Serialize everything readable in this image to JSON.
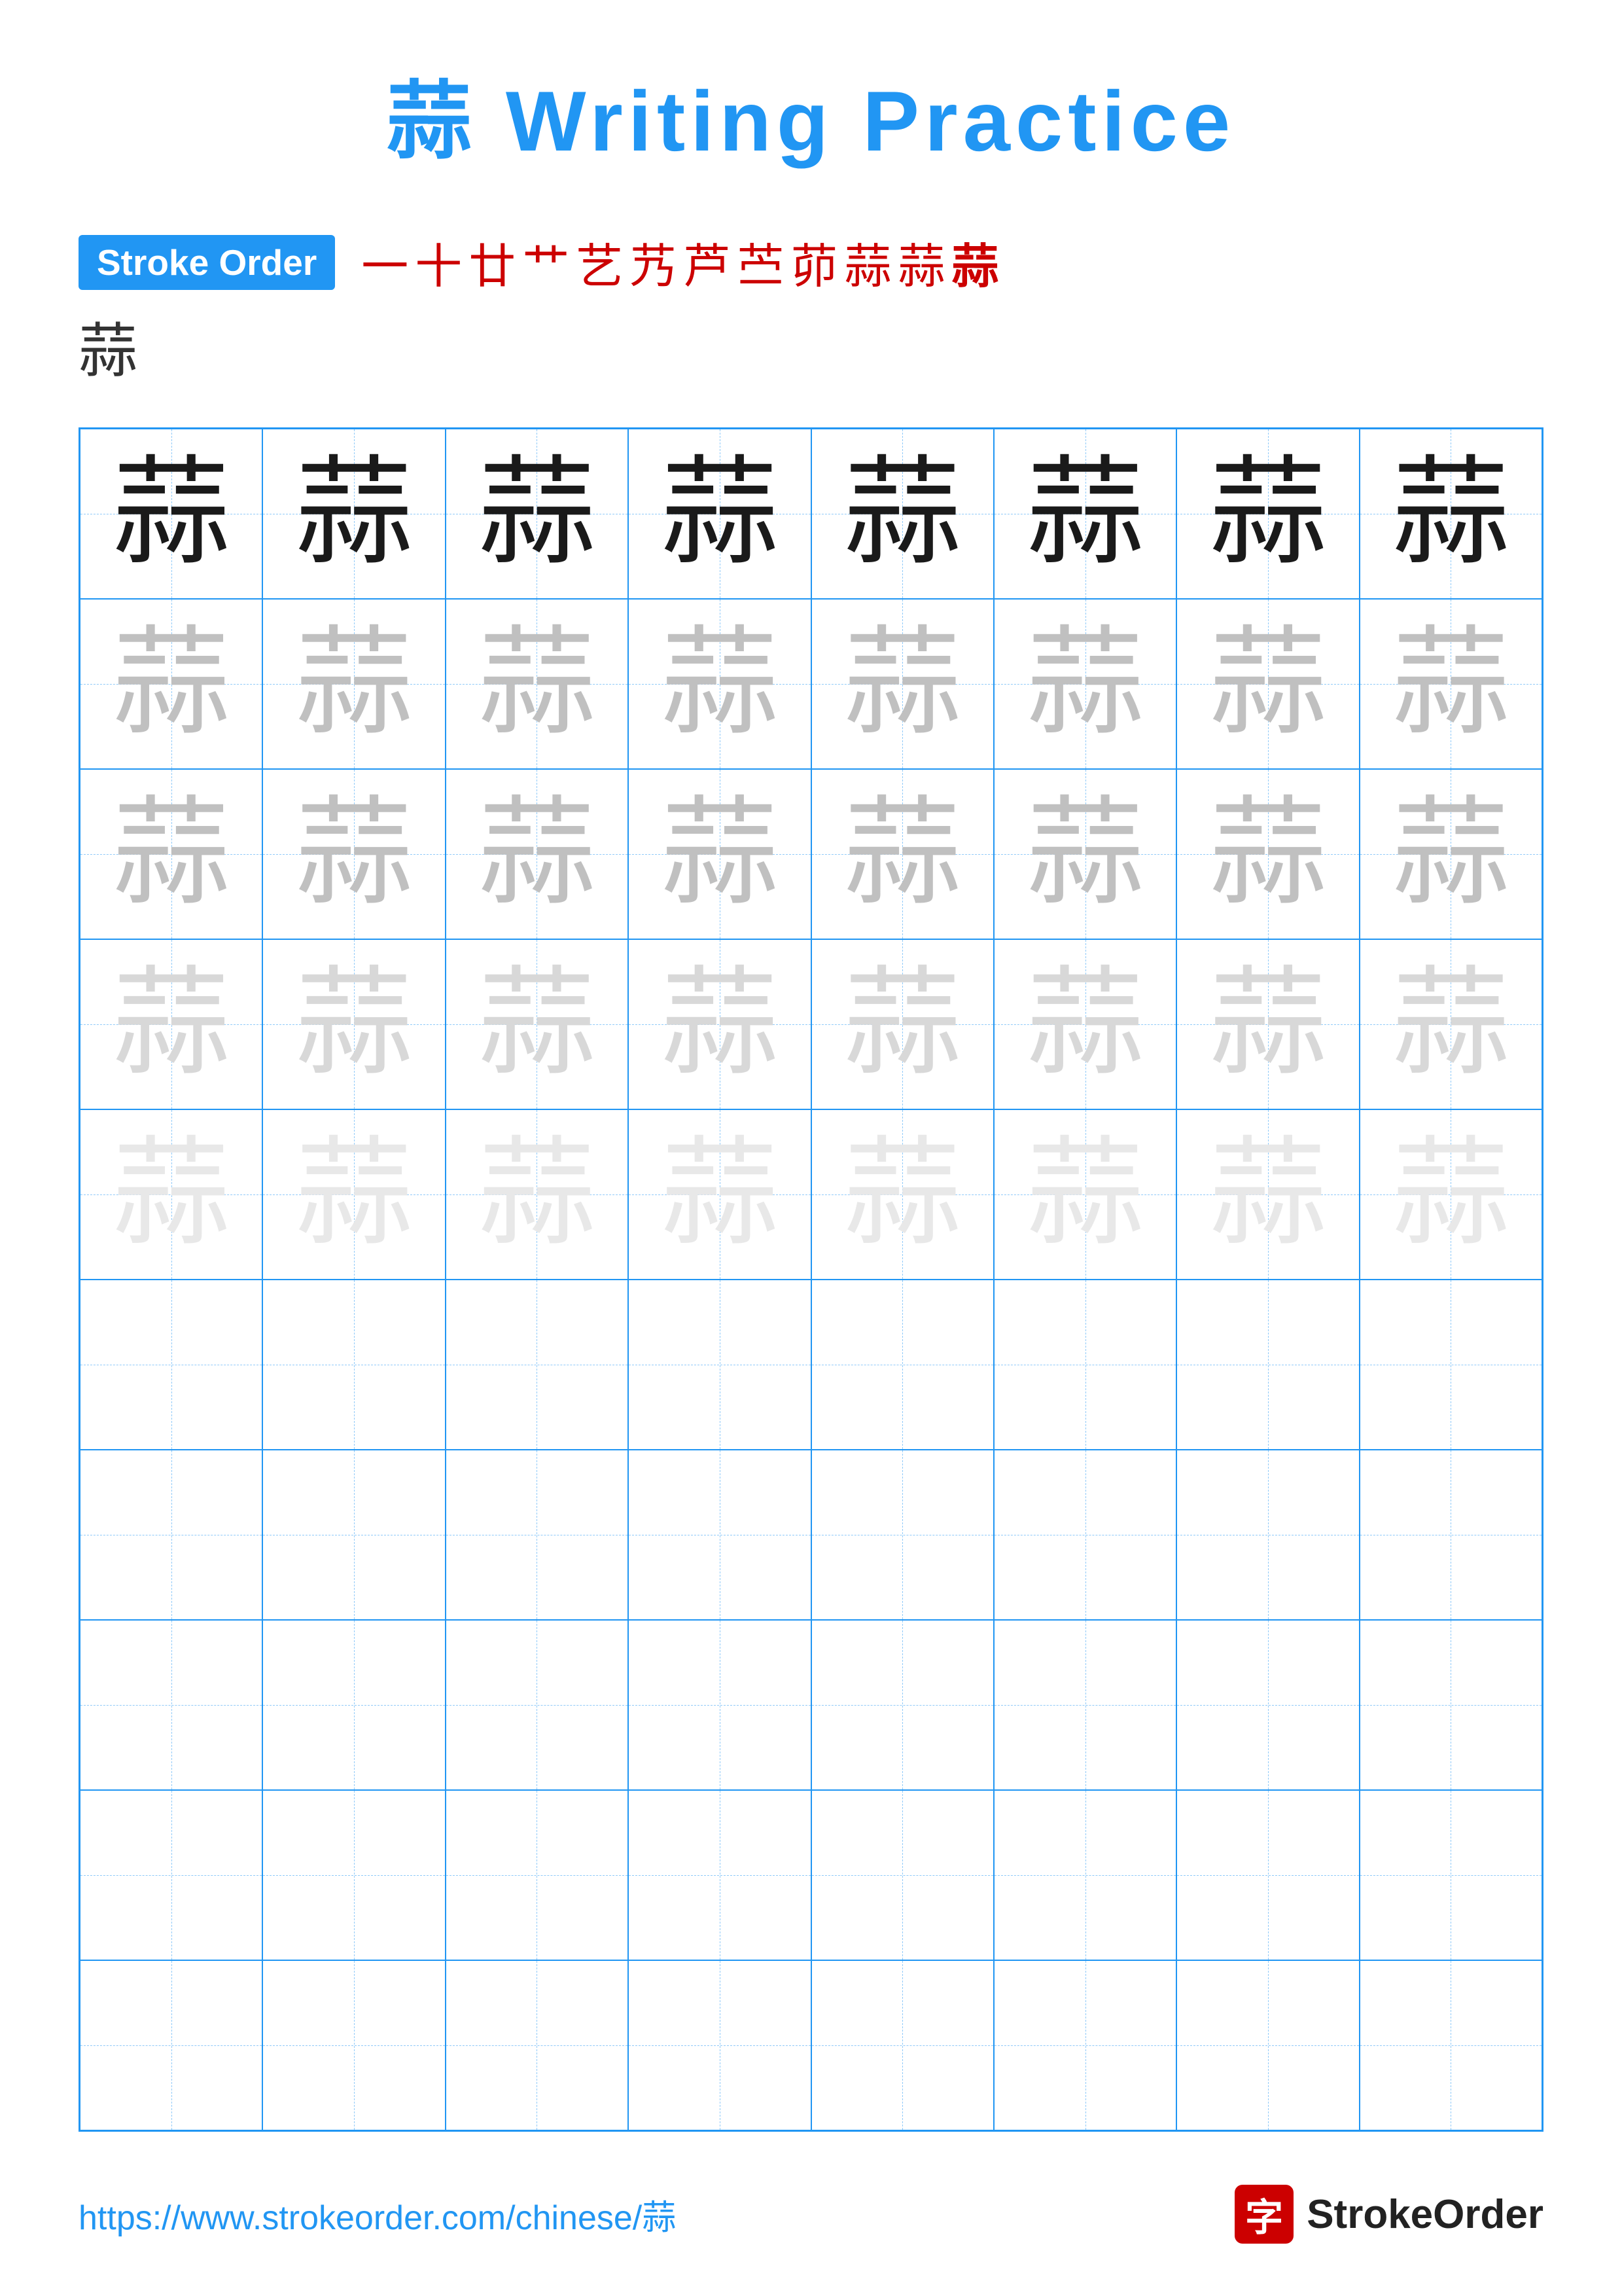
{
  "title": {
    "char": "蒜",
    "text": " Writing Practice",
    "full": "蒜 Writing Practice"
  },
  "stroke_order": {
    "badge_label": "Stroke Order",
    "sequence": [
      "一",
      "十",
      "廿",
      "艹",
      "艺",
      "艿",
      "芦",
      "苎",
      "茆",
      "蒜",
      "蒜",
      "蒜"
    ],
    "final_char": "蒜"
  },
  "grid": {
    "rows": 10,
    "cols": 8,
    "char": "蒜",
    "row_styles": [
      "dark",
      "medium",
      "medium",
      "light",
      "very-light",
      "empty",
      "empty",
      "empty",
      "empty",
      "empty"
    ]
  },
  "footer": {
    "url": "https://www.strokeorder.com/chinese/蒜",
    "brand_char": "字",
    "brand_name": "StrokeOrder"
  }
}
